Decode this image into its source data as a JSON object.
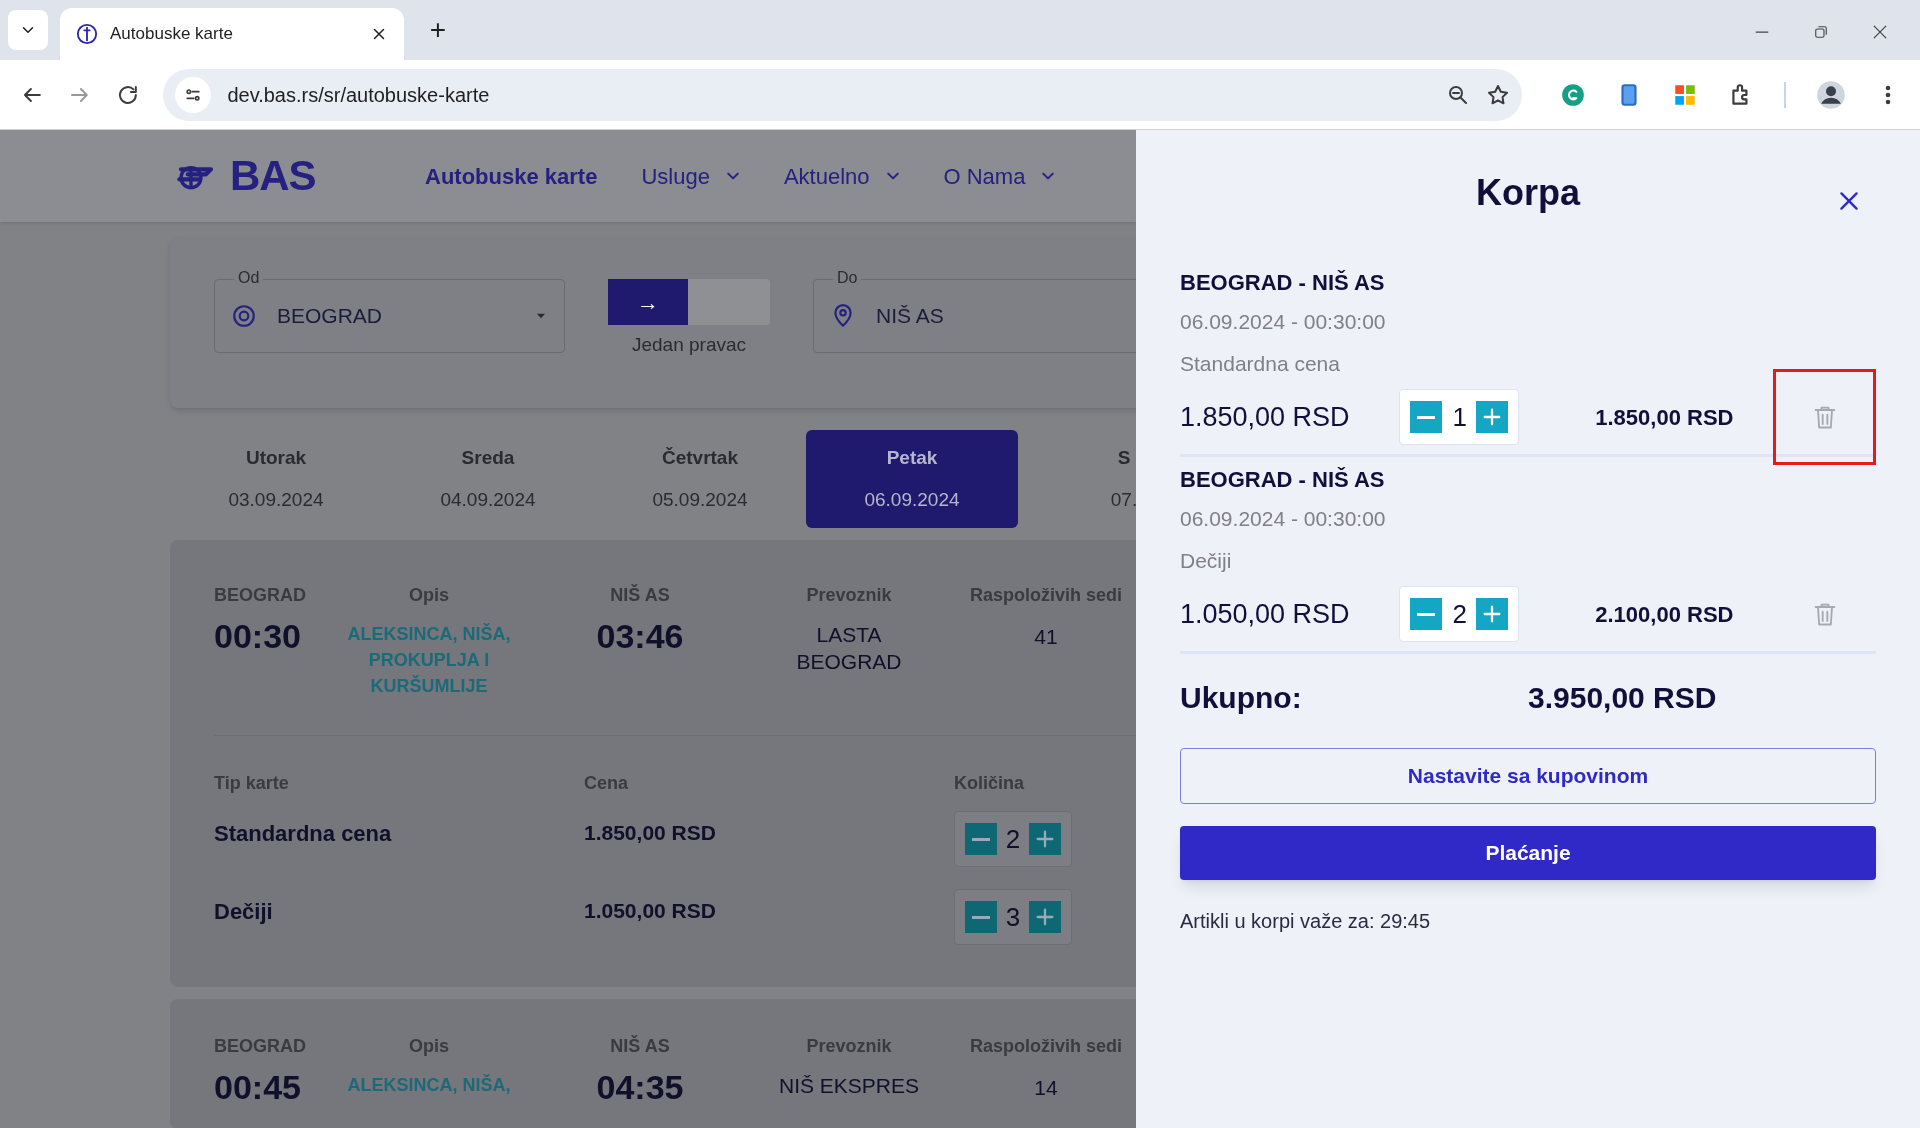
{
  "browser": {
    "tab_title": "Autobuske karte",
    "new_tab": "+",
    "url": "dev.bas.rs/sr/autobuske-karte"
  },
  "header": {
    "logo": "BAS",
    "nav": [
      {
        "label": "Autobuske karte",
        "dropdown": false
      },
      {
        "label": "Usluge",
        "dropdown": true
      },
      {
        "label": "Aktuelno",
        "dropdown": true
      },
      {
        "label": "O Nama",
        "dropdown": true
      }
    ]
  },
  "search": {
    "from": {
      "label": "Od",
      "value": "BEOGRAD"
    },
    "trip_toggle": {
      "icon": "→",
      "label": "Jedan pravac"
    },
    "to": {
      "label": "Do",
      "value": "NIŠ AS"
    }
  },
  "days": [
    {
      "day": "Utorak",
      "date": "03.09.2024",
      "selected": false
    },
    {
      "day": "Sreda",
      "date": "04.09.2024",
      "selected": false
    },
    {
      "day": "Četvrtak",
      "date": "05.09.2024",
      "selected": false
    },
    {
      "day": "Petak",
      "date": "06.09.2024",
      "selected": true
    },
    {
      "day": "S",
      "date": "07.",
      "selected": false
    }
  ],
  "trips": [
    {
      "from": "BEOGRAD",
      "departure": "00:30",
      "description_label": "Opis",
      "description": "ALEKSINCA, NIŠA, PROKUPLJA I KURŠUMLIJE",
      "to": "NIŠ AS",
      "arrival": "03:46",
      "carrier_label": "Prevoznik",
      "carrier": "LASTA BEOGRAD",
      "seats_label": "Raspoloživih sedi",
      "seats": "41",
      "tickets": {
        "columns": [
          "Tip karte",
          "Cena",
          "Količina"
        ],
        "rows": [
          {
            "type": "Standardna cena",
            "price": "1.850,00 RSD",
            "quantity": "2"
          },
          {
            "type": "Dečiji",
            "price": "1.050,00 RSD",
            "quantity": "3"
          }
        ]
      }
    },
    {
      "from": "BEOGRAD",
      "departure": "00:45",
      "description_label": "Opis",
      "description": "ALEKSINCA, NIŠA,",
      "to": "NIŠ AS",
      "arrival": "04:35",
      "carrier_label": "Prevoznik",
      "carrier": "NIŠ EKSPRES",
      "seats_label": "Raspoloživih sedi",
      "seats": "14"
    }
  ],
  "cart": {
    "title": "Korpa",
    "items": [
      {
        "route": "BEOGRAD - NIŠ AS",
        "datetime": "06.09.2024 - 00:30:00",
        "ticket_type": "Standardna cena",
        "price": "1.850,00 RSD",
        "quantity": "1",
        "subtotal": "1.850,00 RSD",
        "highlighted": true
      },
      {
        "route": "BEOGRAD - NIŠ AS",
        "datetime": "06.09.2024 - 00:30:00",
        "ticket_type": "Dečiji",
        "price": "1.050,00 RSD",
        "quantity": "2",
        "subtotal": "2.100,00 RSD",
        "highlighted": false
      }
    ],
    "total_label": "Ukupno:",
    "total": "3.950,00 RSD",
    "continue_button": "Nastavite sa kupovinom",
    "pay_button": "Plaćanje",
    "timer_text": "Artikli u korpi važe za: 29:45"
  }
}
